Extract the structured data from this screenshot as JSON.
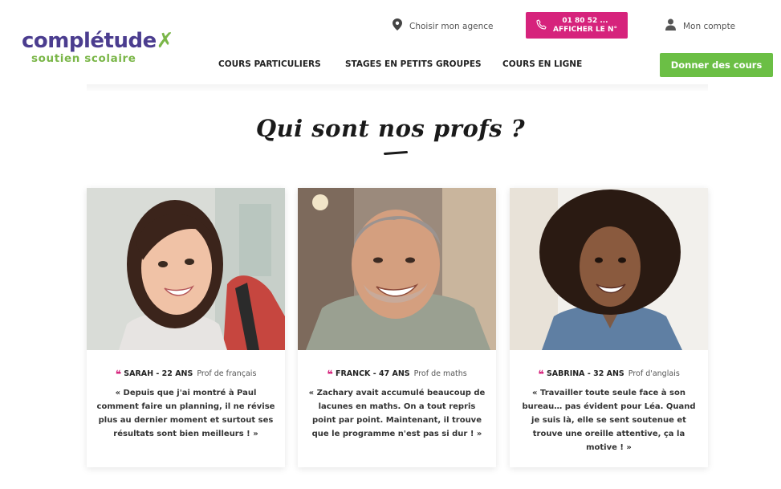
{
  "header": {
    "logo_main": "complétude",
    "logo_sub": "soutien scolaire",
    "agency_label": "Choisir mon agence",
    "phone_number": "01 80 52 ...",
    "phone_cta": "AFFICHER LE N°",
    "account_label": "Mon compte",
    "give_courses_label": "Donner des cours",
    "nav": [
      "COURS PARTICULIERS",
      "STAGES EN PETITS GROUPES",
      "COURS EN LIGNE"
    ]
  },
  "section": {
    "title": "Qui sont nos profs ?"
  },
  "colors": {
    "brand_purple": "#4b3d8f",
    "brand_green": "#7ab648",
    "accent_pink": "#d6237c",
    "button_green": "#6bbf45"
  },
  "cards": [
    {
      "name": "SARAH - 22 ANS",
      "role": "Prof de français",
      "quote": "« Depuis que j'ai montré à Paul comment faire un planning, il ne révise plus au dernier moment et surtout ses résultats sont bien meilleurs ! »"
    },
    {
      "name": "FRANCK - 47 ANS",
      "role": "Prof de maths",
      "quote": "« Zachary avait accumulé beaucoup de lacunes en maths. On a tout repris point par point. Maintenant, il trouve que le programme n'est pas si dur ! »"
    },
    {
      "name": "SABRINA - 32 ANS",
      "role": "Prof d'anglais",
      "quote": "« Travailler toute seule face à son bureau… pas évident pour Léa. Quand je suis là, elle se sent soutenue et trouve une oreille attentive, ça la motive ! »"
    }
  ]
}
